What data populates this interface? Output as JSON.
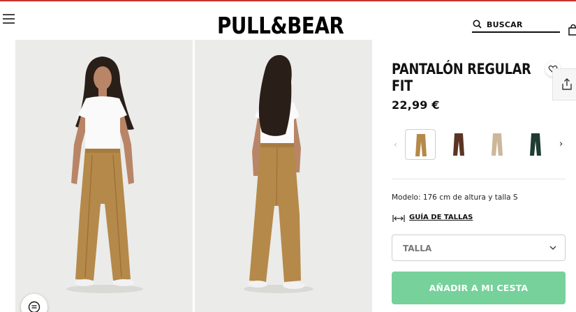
{
  "header": {
    "logo": "PULL&BEAR",
    "search_label": "BUSCAR"
  },
  "product": {
    "title": "PANTALÓN REGULAR FIT",
    "price": "22,99 €",
    "model_info": "Modelo: 176 cm de altura y talla S",
    "size_guide_label": "GUÍA DE TALLAS",
    "size_select_label": "TALLA",
    "add_to_cart_label": "AÑADIR A MI CESTA"
  },
  "colors": {
    "accent_topline": "#c8322e",
    "add_to_cart_bg": "#76d19a",
    "swatches": [
      "#b5894a",
      "#5a3424",
      "#cdb79a",
      "#1f3b33"
    ]
  }
}
